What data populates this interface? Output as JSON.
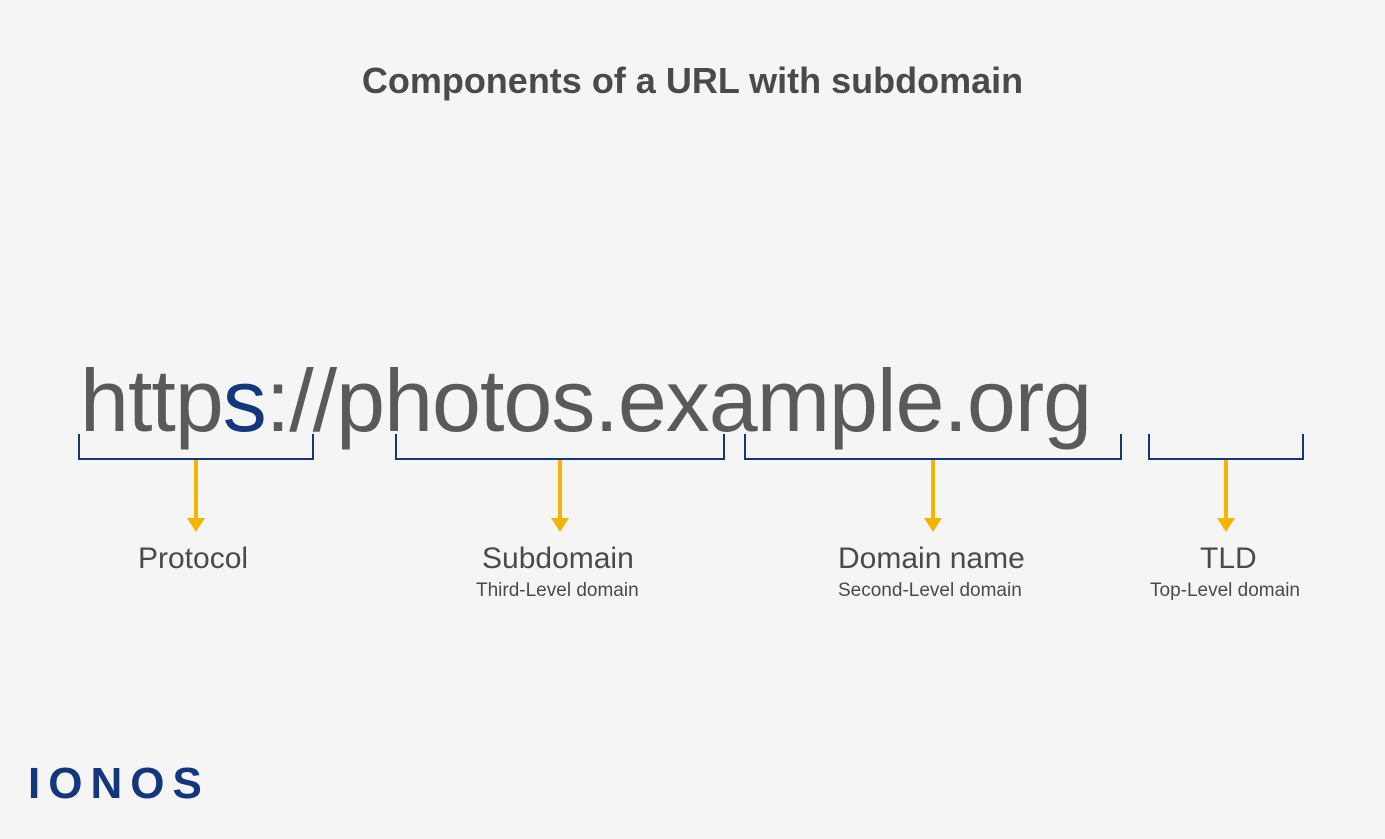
{
  "title": "Components of a URL with subdomain",
  "url": {
    "protocol_part1": "http",
    "protocol_part2_blue": "s",
    "separator": "://",
    "subdomain": "photos",
    "dot1": ".",
    "domain": "example",
    "dot2": ".",
    "tld": "org"
  },
  "labels": {
    "protocol": {
      "primary": "Protocol",
      "secondary": ""
    },
    "subdomain": {
      "primary": "Subdomain",
      "secondary": "Third-Level domain"
    },
    "domain": {
      "primary": "Domain name",
      "secondary": "Second-Level domain"
    },
    "tld": {
      "primary": "TLD",
      "secondary": "Top-Level domain"
    }
  },
  "logo": "IONOS"
}
